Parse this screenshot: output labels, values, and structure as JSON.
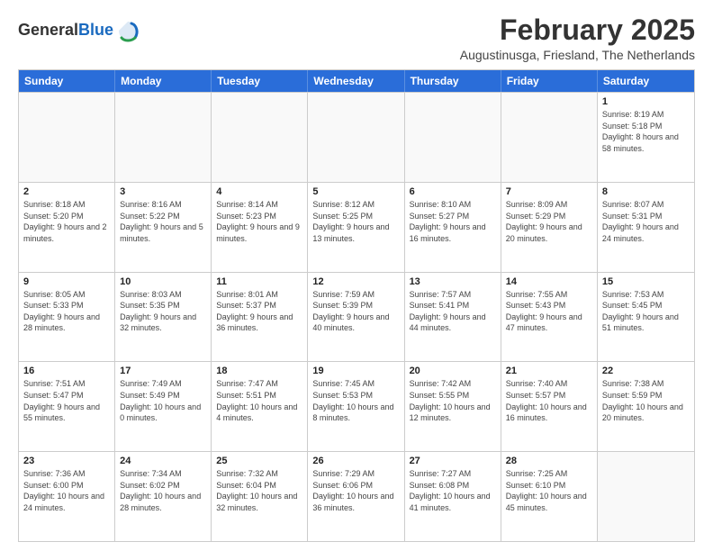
{
  "logo": {
    "general": "General",
    "blue": "Blue"
  },
  "title": {
    "month": "February 2025",
    "location": "Augustinusga, Friesland, The Netherlands"
  },
  "weekdays": [
    "Sunday",
    "Monday",
    "Tuesday",
    "Wednesday",
    "Thursday",
    "Friday",
    "Saturday"
  ],
  "weeks": [
    [
      {
        "day": "",
        "info": "",
        "empty": true
      },
      {
        "day": "",
        "info": "",
        "empty": true
      },
      {
        "day": "",
        "info": "",
        "empty": true
      },
      {
        "day": "",
        "info": "",
        "empty": true
      },
      {
        "day": "",
        "info": "",
        "empty": true
      },
      {
        "day": "",
        "info": "",
        "empty": true
      },
      {
        "day": "1",
        "info": "Sunrise: 8:19 AM\nSunset: 5:18 PM\nDaylight: 8 hours and 58 minutes.",
        "empty": false
      }
    ],
    [
      {
        "day": "2",
        "info": "Sunrise: 8:18 AM\nSunset: 5:20 PM\nDaylight: 9 hours and 2 minutes.",
        "empty": false
      },
      {
        "day": "3",
        "info": "Sunrise: 8:16 AM\nSunset: 5:22 PM\nDaylight: 9 hours and 5 minutes.",
        "empty": false
      },
      {
        "day": "4",
        "info": "Sunrise: 8:14 AM\nSunset: 5:23 PM\nDaylight: 9 hours and 9 minutes.",
        "empty": false
      },
      {
        "day": "5",
        "info": "Sunrise: 8:12 AM\nSunset: 5:25 PM\nDaylight: 9 hours and 13 minutes.",
        "empty": false
      },
      {
        "day": "6",
        "info": "Sunrise: 8:10 AM\nSunset: 5:27 PM\nDaylight: 9 hours and 16 minutes.",
        "empty": false
      },
      {
        "day": "7",
        "info": "Sunrise: 8:09 AM\nSunset: 5:29 PM\nDaylight: 9 hours and 20 minutes.",
        "empty": false
      },
      {
        "day": "8",
        "info": "Sunrise: 8:07 AM\nSunset: 5:31 PM\nDaylight: 9 hours and 24 minutes.",
        "empty": false
      }
    ],
    [
      {
        "day": "9",
        "info": "Sunrise: 8:05 AM\nSunset: 5:33 PM\nDaylight: 9 hours and 28 minutes.",
        "empty": false
      },
      {
        "day": "10",
        "info": "Sunrise: 8:03 AM\nSunset: 5:35 PM\nDaylight: 9 hours and 32 minutes.",
        "empty": false
      },
      {
        "day": "11",
        "info": "Sunrise: 8:01 AM\nSunset: 5:37 PM\nDaylight: 9 hours and 36 minutes.",
        "empty": false
      },
      {
        "day": "12",
        "info": "Sunrise: 7:59 AM\nSunset: 5:39 PM\nDaylight: 9 hours and 40 minutes.",
        "empty": false
      },
      {
        "day": "13",
        "info": "Sunrise: 7:57 AM\nSunset: 5:41 PM\nDaylight: 9 hours and 44 minutes.",
        "empty": false
      },
      {
        "day": "14",
        "info": "Sunrise: 7:55 AM\nSunset: 5:43 PM\nDaylight: 9 hours and 47 minutes.",
        "empty": false
      },
      {
        "day": "15",
        "info": "Sunrise: 7:53 AM\nSunset: 5:45 PM\nDaylight: 9 hours and 51 minutes.",
        "empty": false
      }
    ],
    [
      {
        "day": "16",
        "info": "Sunrise: 7:51 AM\nSunset: 5:47 PM\nDaylight: 9 hours and 55 minutes.",
        "empty": false
      },
      {
        "day": "17",
        "info": "Sunrise: 7:49 AM\nSunset: 5:49 PM\nDaylight: 10 hours and 0 minutes.",
        "empty": false
      },
      {
        "day": "18",
        "info": "Sunrise: 7:47 AM\nSunset: 5:51 PM\nDaylight: 10 hours and 4 minutes.",
        "empty": false
      },
      {
        "day": "19",
        "info": "Sunrise: 7:45 AM\nSunset: 5:53 PM\nDaylight: 10 hours and 8 minutes.",
        "empty": false
      },
      {
        "day": "20",
        "info": "Sunrise: 7:42 AM\nSunset: 5:55 PM\nDaylight: 10 hours and 12 minutes.",
        "empty": false
      },
      {
        "day": "21",
        "info": "Sunrise: 7:40 AM\nSunset: 5:57 PM\nDaylight: 10 hours and 16 minutes.",
        "empty": false
      },
      {
        "day": "22",
        "info": "Sunrise: 7:38 AM\nSunset: 5:59 PM\nDaylight: 10 hours and 20 minutes.",
        "empty": false
      }
    ],
    [
      {
        "day": "23",
        "info": "Sunrise: 7:36 AM\nSunset: 6:00 PM\nDaylight: 10 hours and 24 minutes.",
        "empty": false
      },
      {
        "day": "24",
        "info": "Sunrise: 7:34 AM\nSunset: 6:02 PM\nDaylight: 10 hours and 28 minutes.",
        "empty": false
      },
      {
        "day": "25",
        "info": "Sunrise: 7:32 AM\nSunset: 6:04 PM\nDaylight: 10 hours and 32 minutes.",
        "empty": false
      },
      {
        "day": "26",
        "info": "Sunrise: 7:29 AM\nSunset: 6:06 PM\nDaylight: 10 hours and 36 minutes.",
        "empty": false
      },
      {
        "day": "27",
        "info": "Sunrise: 7:27 AM\nSunset: 6:08 PM\nDaylight: 10 hours and 41 minutes.",
        "empty": false
      },
      {
        "day": "28",
        "info": "Sunrise: 7:25 AM\nSunset: 6:10 PM\nDaylight: 10 hours and 45 minutes.",
        "empty": false
      },
      {
        "day": "",
        "info": "",
        "empty": true
      }
    ]
  ]
}
